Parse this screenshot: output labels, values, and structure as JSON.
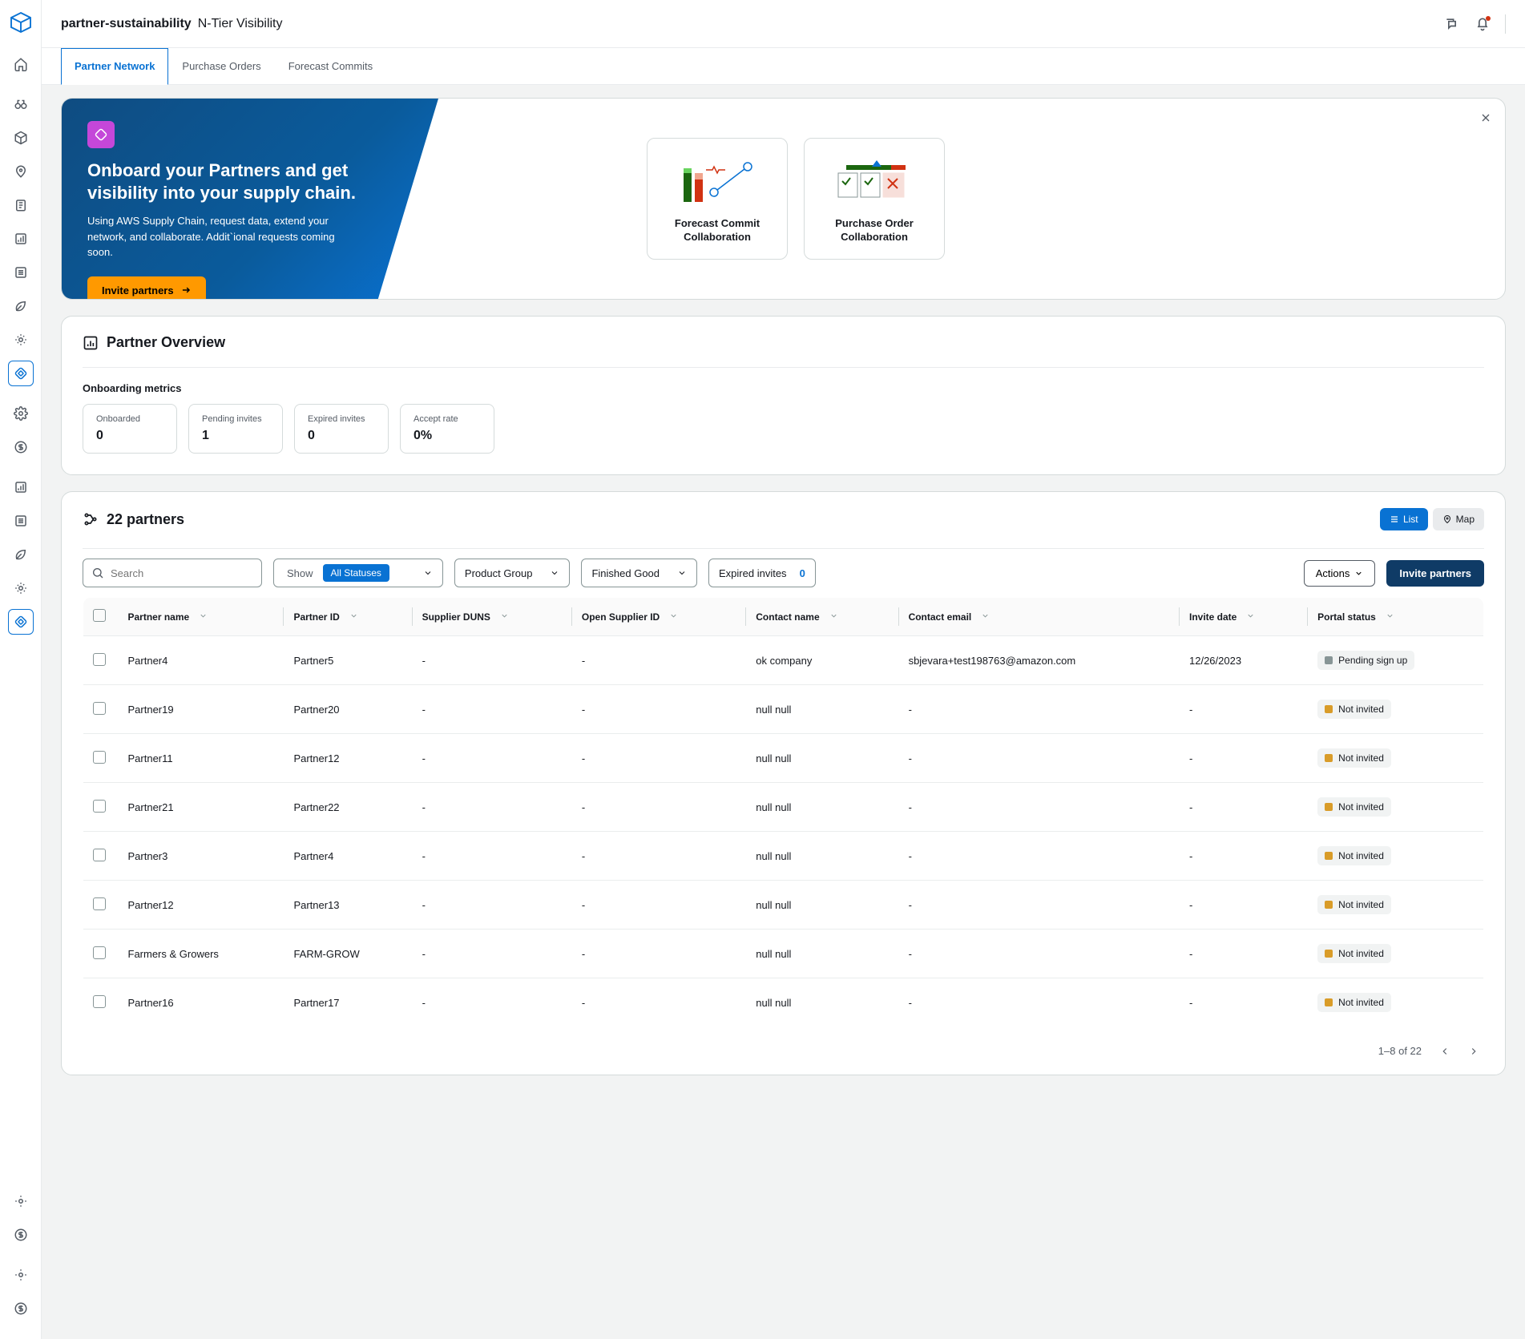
{
  "breadcrumb": {
    "org": "partner-sustainability",
    "page": "N-Tier Visibility"
  },
  "tabs": [
    {
      "label": "Partner Network",
      "active": true
    },
    {
      "label": "Purchase Orders",
      "active": false
    },
    {
      "label": "Forecast Commits",
      "active": false
    }
  ],
  "hero": {
    "title": "Onboard your Partners and get visibility into your supply chain.",
    "description": "Using AWS Supply Chain, request data, extend your network, and collaborate. Addit`ional requests coming soon.",
    "cta": "Invite partners",
    "tiles": [
      {
        "label": "Forecast Commit Collaboration"
      },
      {
        "label": "Purchase Order Collaboration"
      }
    ]
  },
  "overview": {
    "title": "Partner Overview",
    "metrics_heading": "Onboarding metrics",
    "metrics": [
      {
        "label": "Onboarded",
        "value": "0"
      },
      {
        "label": "Pending invites",
        "value": "1"
      },
      {
        "label": "Expired invites",
        "value": "0"
      },
      {
        "label": "Accept rate",
        "value": "0%"
      }
    ]
  },
  "partners": {
    "title": "22 partners",
    "view": {
      "list": "List",
      "map": "Map"
    },
    "toolbar": {
      "search_placeholder": "Search",
      "show_label": "Show",
      "status_filter": "All Statuses",
      "product_group": "Product Group",
      "finished_good": "Finished Good",
      "expired_invites_label": "Expired invites",
      "expired_invites_count": "0",
      "actions": "Actions",
      "invite": "Invite partners"
    },
    "columns": [
      "Partner name",
      "Partner ID",
      "Supplier DUNS",
      "Open Supplier ID",
      "Contact name",
      "Contact email",
      "Invite date",
      "Portal status"
    ],
    "rows": [
      {
        "name": "Partner4",
        "pid": "Partner5",
        "duns": "-",
        "osid": "-",
        "contact": "ok company",
        "email": "sbjevara+test198763@amazon.com",
        "date": "12/26/2023",
        "status": "Pending sign up",
        "status_color": "grey"
      },
      {
        "name": "Partner19",
        "pid": "Partner20",
        "duns": "-",
        "osid": "-",
        "contact": "null null",
        "email": "-",
        "date": "-",
        "status": "Not invited",
        "status_color": "amber"
      },
      {
        "name": "Partner11",
        "pid": "Partner12",
        "duns": "-",
        "osid": "-",
        "contact": "null null",
        "email": "-",
        "date": "-",
        "status": "Not invited",
        "status_color": "amber"
      },
      {
        "name": "Partner21",
        "pid": "Partner22",
        "duns": "-",
        "osid": "-",
        "contact": "null null",
        "email": "-",
        "date": "-",
        "status": "Not invited",
        "status_color": "amber"
      },
      {
        "name": "Partner3",
        "pid": "Partner4",
        "duns": "-",
        "osid": "-",
        "contact": "null null",
        "email": "-",
        "date": "-",
        "status": "Not invited",
        "status_color": "amber"
      },
      {
        "name": "Partner12",
        "pid": "Partner13",
        "duns": "-",
        "osid": "-",
        "contact": "null null",
        "email": "-",
        "date": "-",
        "status": "Not invited",
        "status_color": "amber"
      },
      {
        "name": "Farmers & Growers",
        "pid": "FARM-GROW",
        "duns": "-",
        "osid": "-",
        "contact": "null null",
        "email": "-",
        "date": "-",
        "status": "Not invited",
        "status_color": "amber"
      },
      {
        "name": "Partner16",
        "pid": "Partner17",
        "duns": "-",
        "osid": "-",
        "contact": "null null",
        "email": "-",
        "date": "-",
        "status": "Not invited",
        "status_color": "amber"
      }
    ],
    "pagination": "1–8 of 22"
  }
}
